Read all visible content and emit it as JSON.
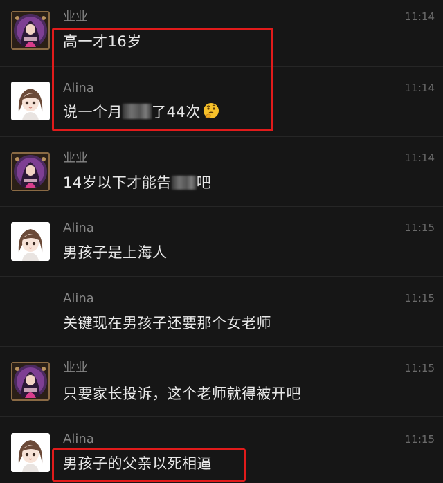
{
  "messages": [
    {
      "sender": "业业",
      "time": "11:14",
      "text": "高一才16岁",
      "avatar": "anime-girl-avatar"
    },
    {
      "sender": "Alina",
      "time": "11:14",
      "text_before": "说一个月",
      "text_after": "了44次",
      "obscured": "pixelated-censored-text",
      "emoji": "thinking-face-emoji",
      "avatar": "cartoon-girl-avatar"
    },
    {
      "sender": "业业",
      "time": "11:14",
      "text_before": "14岁以下才能告",
      "text_after": "吧",
      "obscured": "pixelated-censored-text",
      "avatar": "anime-girl-avatar"
    },
    {
      "sender": "Alina",
      "time": "11:15",
      "text": "男孩子是上海人",
      "avatar": "cartoon-girl-avatar"
    },
    {
      "sender": "Alina",
      "time": "11:15",
      "text": "关键现在男孩子还要那个女老师"
    },
    {
      "sender": "业业",
      "time": "11:15",
      "text": "只要家长投诉，这个老师就得被开吧",
      "avatar": "anime-girl-avatar"
    },
    {
      "sender": "Alina",
      "time": "11:15",
      "text": "男孩子的父亲以死相逼",
      "avatar": "cartoon-girl-avatar"
    }
  ],
  "highlight_color": "#e11b1b",
  "background_color": "#161616"
}
